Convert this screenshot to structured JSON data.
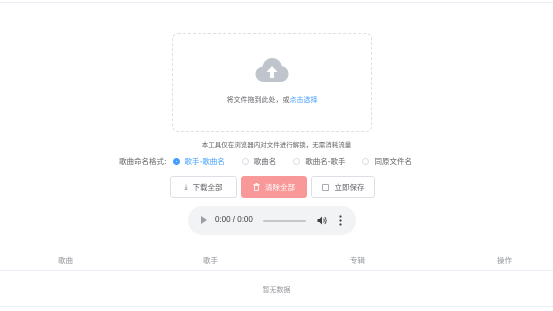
{
  "upload": {
    "hint": "将文件拖到此处，或",
    "link": "点击选择"
  },
  "tip": "本工具仅在浏览器内对文件进行解锁，无需消耗流量",
  "naming": {
    "label": "歌曲命名格式:",
    "options": [
      {
        "label": "歌手-歌曲名",
        "checked": true
      },
      {
        "label": "歌曲名",
        "checked": false
      },
      {
        "label": "歌曲名-歌手",
        "checked": false
      },
      {
        "label": "同原文件名",
        "checked": false
      }
    ]
  },
  "buttons": {
    "download_all": "下载全部",
    "clear_all": "清除全部",
    "save_now": "立即保存"
  },
  "player": {
    "time": "0:00 / 0:00"
  },
  "table": {
    "headers": [
      "歌曲",
      "歌手",
      "专辑",
      "操作"
    ],
    "empty": "暂无数据"
  },
  "colors": {
    "primary": "#409eff",
    "danger_light": "#f89898",
    "border": "#dcdfe6"
  }
}
